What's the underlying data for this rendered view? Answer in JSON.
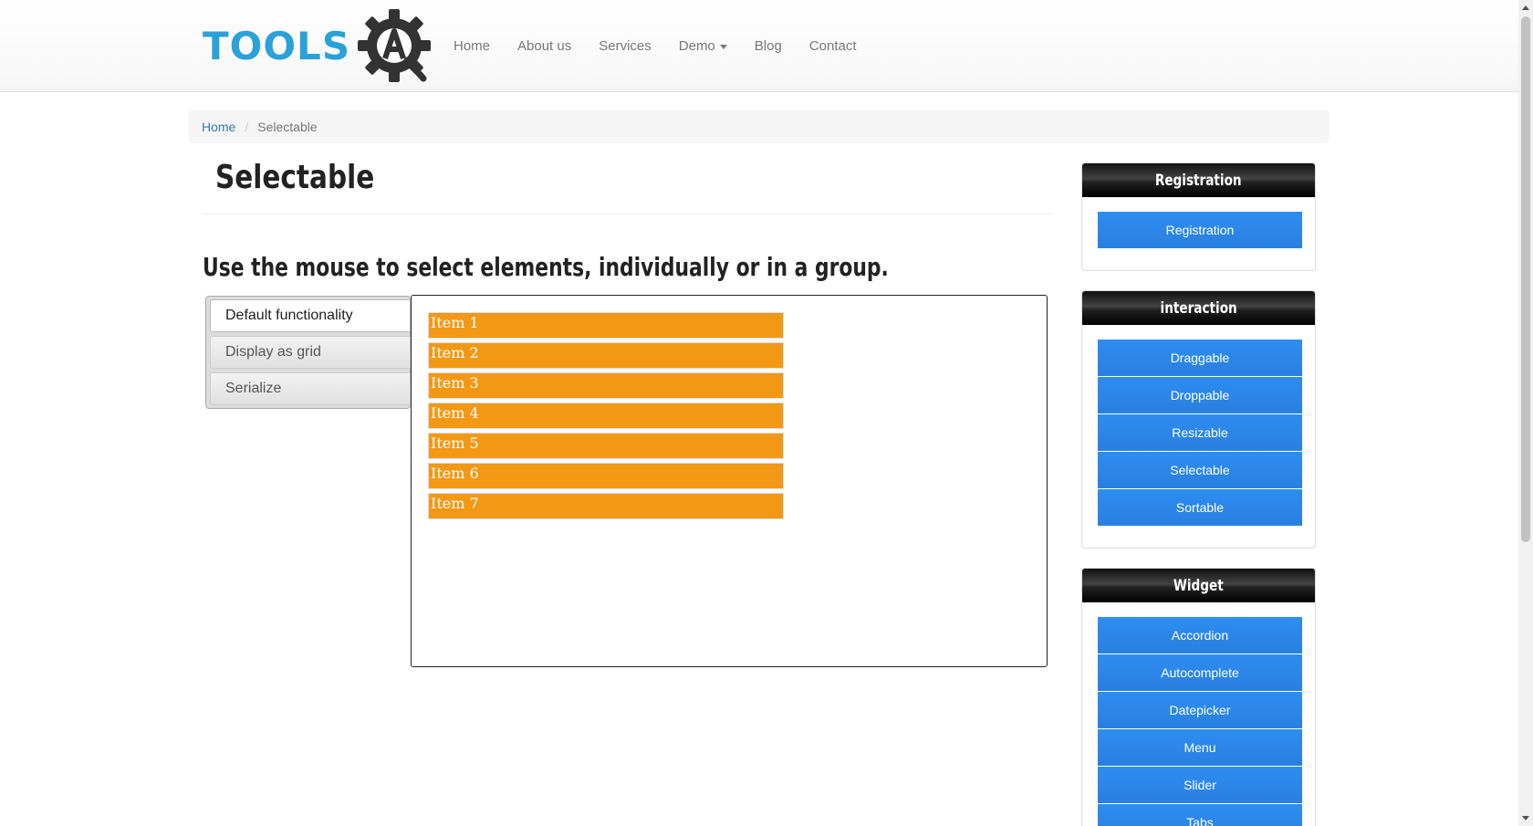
{
  "header": {
    "logo_text": "TOOLS",
    "nav": [
      {
        "label": "Home"
      },
      {
        "label": "About us"
      },
      {
        "label": "Services"
      },
      {
        "label": "Demo",
        "dropdown": true
      },
      {
        "label": "Blog"
      },
      {
        "label": "Contact"
      }
    ]
  },
  "breadcrumb": {
    "home": "Home",
    "separator": "/",
    "current": "Selectable"
  },
  "main": {
    "title": "Selectable",
    "subtitle": "Use the mouse to select elements, individually or in a group.",
    "tabs": [
      {
        "label": "Default functionality",
        "active": true
      },
      {
        "label": "Display as grid",
        "active": false
      },
      {
        "label": "Serialize",
        "active": false
      }
    ],
    "items": [
      "Item 1",
      "Item 2",
      "Item 3",
      "Item 4",
      "Item 5",
      "Item 6",
      "Item 7"
    ]
  },
  "sidebar": {
    "registration": {
      "heading": "Registration",
      "buttons": [
        "Registration"
      ]
    },
    "interaction": {
      "heading": "interaction",
      "buttons": [
        "Draggable",
        "Droppable",
        "Resizable",
        "Selectable",
        "Sortable"
      ]
    },
    "widget": {
      "heading": "Widget",
      "buttons": [
        "Accordion",
        "Autocomplete",
        "Datepicker",
        "Menu",
        "Slider",
        "Tabs"
      ]
    }
  },
  "colors": {
    "item_bg": "#f39814",
    "side_button": "#2a86e8",
    "logo_blue": "#2aa1d8",
    "link": "#337ab7"
  }
}
